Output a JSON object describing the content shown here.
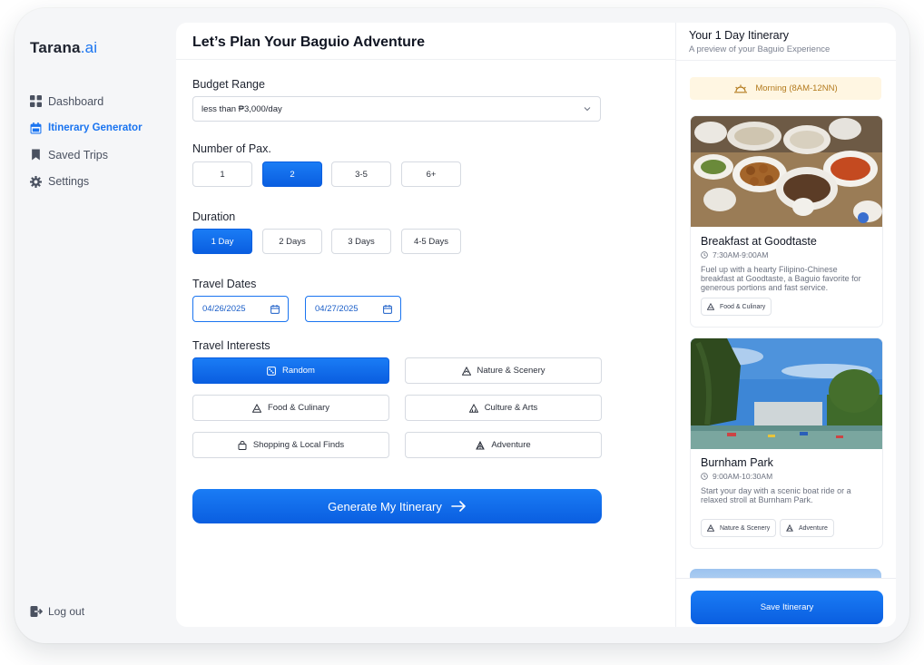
{
  "brand": {
    "name": "Tarana",
    "suffix": ".ai"
  },
  "sidebar": {
    "items": [
      {
        "label": "Dashboard",
        "icon": "grid-icon"
      },
      {
        "label": "Itinerary Generator",
        "icon": "calendar-icon",
        "active": true
      },
      {
        "label": "Saved Trips",
        "icon": "bookmark-icon"
      },
      {
        "label": "Settings",
        "icon": "gear-icon"
      }
    ],
    "logout": "Log out"
  },
  "main": {
    "title": "Let’s Plan Your Baguio Adventure",
    "budget": {
      "label": "Budget Range",
      "value": "less than ₱3,000/day"
    },
    "pax": {
      "label": "Number of Pax.",
      "options": [
        "1",
        "2",
        "3-5",
        "6+"
      ],
      "selected": "2"
    },
    "duration": {
      "label": "Duration",
      "options": [
        "1 Day",
        "2 Days",
        "3 Days",
        "4-5 Days"
      ],
      "selected": "1 Day"
    },
    "dates": {
      "label": "Travel Dates",
      "start": "04/26/2025",
      "end": "04/27/2025"
    },
    "interests": {
      "label": "Travel Interests",
      "options": [
        "Random",
        "Nature & Scenery",
        "Food & Culinary",
        "Culture & Arts",
        "Shopping & Local Finds",
        "Adventure"
      ],
      "selected": "Random"
    },
    "generate_label": "Generate My Itinerary"
  },
  "itinerary": {
    "title": "Your 1 Day Itinerary",
    "subtitle": "A preview of your Baguio Experience",
    "slot": "Morning (8AM-12NN)",
    "cards": [
      {
        "title": "Breakfast at Goodtaste",
        "time": "7:30AM-9:00AM",
        "description": "Fuel up with a hearty Filipino-Chinese breakfast at Goodtaste, a Baguio favorite for generous portions and fast service.",
        "tags": [
          "Food & Culinary"
        ]
      },
      {
        "title": "Burnham Park",
        "time": "9:00AM-10:30AM",
        "description": "Start your day with a scenic boat ride or a relaxed stroll at Burnham Park.",
        "tags": [
          "Nature & Scenery",
          "Adventure"
        ]
      }
    ],
    "save_label": "Save Itinerary"
  },
  "colors": {
    "accent": "#1a74f0",
    "slot_bg": "#fff6e2",
    "slot_text": "#b37a1d"
  }
}
